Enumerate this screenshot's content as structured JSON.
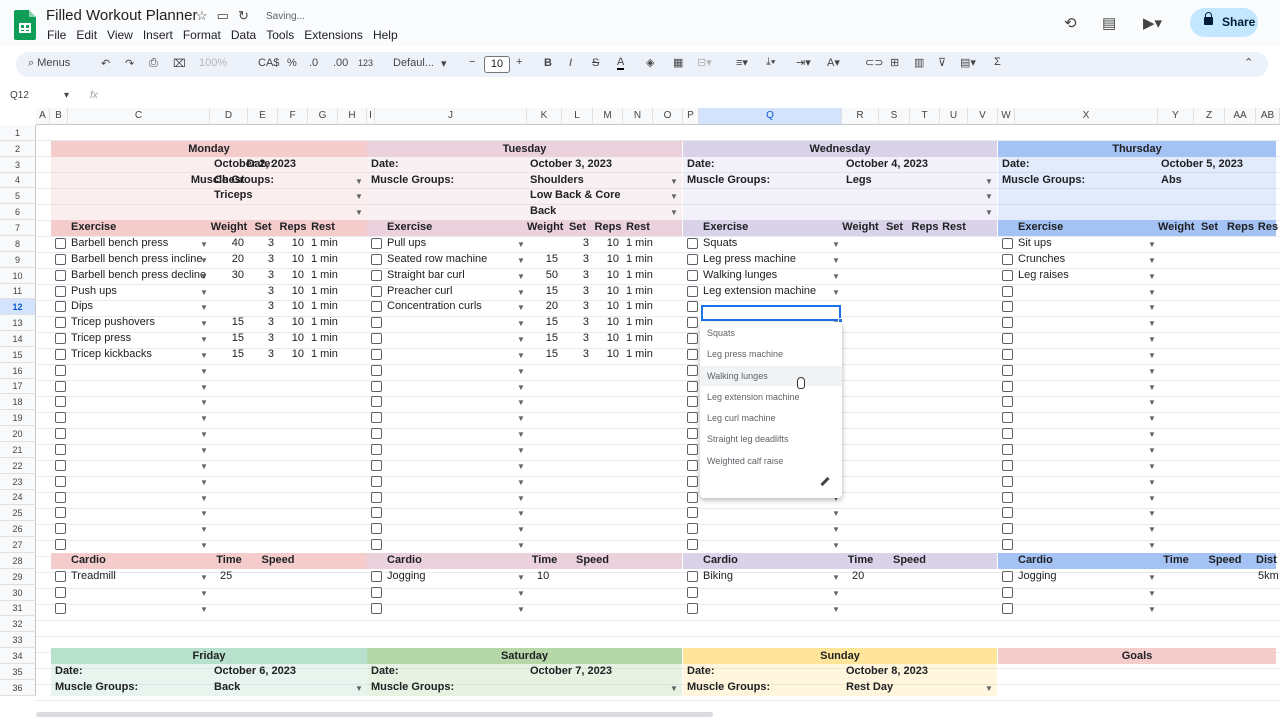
{
  "app": {
    "title": "Filled Workout Planner",
    "saving": "Saving...",
    "menus": [
      "File",
      "Edit",
      "View",
      "Insert",
      "Format",
      "Data",
      "Tools",
      "Extensions",
      "Help"
    ],
    "share": "Share"
  },
  "toolbar": {
    "search": "Menus",
    "zoom": "100%",
    "currency": "CA$",
    "percent": "%",
    "dec_less": ".0",
    "dec_more": ".00",
    "number_format": "123",
    "font": "Defaul...",
    "font_size": "10"
  },
  "formula": {
    "cell_ref": "Q12",
    "fx": "fx",
    "value": ""
  },
  "columns": [
    "A",
    "B",
    "C",
    "D",
    "E",
    "F",
    "G",
    "H",
    "I",
    "J",
    "K",
    "L",
    "M",
    "N",
    "O",
    "P",
    "Q",
    "R",
    "S",
    "T",
    "U",
    "V",
    "W",
    "X",
    "Y",
    "Z",
    "AA",
    "AB"
  ],
  "rows": [
    "1",
    "2",
    "3",
    "4",
    "5",
    "6",
    "7",
    "8",
    "9",
    "10",
    "11",
    "12",
    "13",
    "14",
    "15",
    "16",
    "17",
    "18",
    "19",
    "20",
    "21",
    "22",
    "23",
    "24",
    "25",
    "26",
    "27",
    "28",
    "29",
    "30",
    "31",
    "32",
    "33",
    "34",
    "35",
    "36"
  ],
  "labels": {
    "date": "Date:",
    "muscle": "Muscle Groups:",
    "exercise": "Exercise",
    "weight": "Weight",
    "set": "Set",
    "reps": "Reps",
    "rest": "Rest",
    "time": "Time",
    "cardio": "Cardio",
    "speed": "Speed",
    "distance": "Distance",
    "distance_cut": "Dist",
    "reps_cut": "Reps",
    "rest_cut": "Res"
  },
  "days": [
    {
      "name": "Monday",
      "date": "October 2, 2023",
      "muscles": [
        "Chest",
        "Triceps",
        ""
      ],
      "exercises": [
        {
          "name": "Barbell bench press",
          "weight": "40",
          "set": "3",
          "reps": "10",
          "rest": "1 min"
        },
        {
          "name": "Barbell bench press incline",
          "weight": "20",
          "set": "3",
          "reps": "10",
          "rest": "1 min"
        },
        {
          "name": "Barbell bench press decline",
          "weight": "30",
          "set": "3",
          "reps": "10",
          "rest": "1 min"
        },
        {
          "name": "Push ups",
          "weight": "",
          "set": "3",
          "reps": "10",
          "rest": "1 min"
        },
        {
          "name": "Dips",
          "weight": "",
          "set": "3",
          "reps": "10",
          "rest": "1 min"
        },
        {
          "name": "Tricep pushovers",
          "weight": "15",
          "set": "3",
          "reps": "10",
          "rest": "1 min"
        },
        {
          "name": "Tricep press",
          "weight": "15",
          "set": "3",
          "reps": "10",
          "rest": "1 min"
        },
        {
          "name": "Tricep kickbacks",
          "weight": "15",
          "set": "3",
          "reps": "10",
          "rest": "1 min"
        }
      ],
      "cardio": {
        "name": "Treadmill",
        "time": "25"
      }
    },
    {
      "name": "Tuesday",
      "date": "October 3, 2023",
      "muscles": [
        "Shoulders",
        "Low Back & Core",
        "Back"
      ],
      "exercises": [
        {
          "name": "Pull ups",
          "weight": "",
          "set": "3",
          "reps": "10",
          "rest": "1 min"
        },
        {
          "name": "Seated row machine",
          "weight": "15",
          "set": "3",
          "reps": "10",
          "rest": "1 min"
        },
        {
          "name": "Straight bar curl",
          "weight": "50",
          "set": "3",
          "reps": "10",
          "rest": "1 min"
        },
        {
          "name": "Preacher curl",
          "weight": "15",
          "set": "3",
          "reps": "10",
          "rest": "1 min"
        },
        {
          "name": "Concentration curls",
          "weight": "20",
          "set": "3",
          "reps": "10",
          "rest": "1 min"
        },
        {
          "name": "",
          "weight": "15",
          "set": "3",
          "reps": "10",
          "rest": "1 min"
        },
        {
          "name": "",
          "weight": "15",
          "set": "3",
          "reps": "10",
          "rest": "1 min"
        },
        {
          "name": "",
          "weight": "15",
          "set": "3",
          "reps": "10",
          "rest": "1 min"
        }
      ],
      "cardio": {
        "name": "Jogging",
        "time": "10"
      }
    },
    {
      "name": "Wednesday",
      "date": "October 4, 2023",
      "muscles": [
        "Legs",
        "",
        ""
      ],
      "exercises": [
        {
          "name": "Squats"
        },
        {
          "name": "Leg press machine"
        },
        {
          "name": "Walking lunges"
        },
        {
          "name": "Leg extension machine"
        }
      ],
      "cardio": {
        "name": "Biking",
        "time": "20"
      }
    },
    {
      "name": "Thursday",
      "date": "October 5, 2023",
      "muscles": [
        "Abs",
        "",
        ""
      ],
      "exercises": [
        {
          "name": "Sit ups"
        },
        {
          "name": "Crunches"
        },
        {
          "name": "Leg raises"
        }
      ],
      "cardio": {
        "name": "Jogging",
        "time": "",
        "distance": "5km"
      }
    }
  ],
  "week2": [
    {
      "name": "Friday",
      "date": "October 6, 2023",
      "muscle": "Back"
    },
    {
      "name": "Saturday",
      "date": "October 7, 2023",
      "muscle": ""
    },
    {
      "name": "Sunday",
      "date": "October 8, 2023",
      "muscle": "Rest Day"
    },
    {
      "name": "Goals"
    }
  ],
  "dropdown": {
    "options": [
      "Squats",
      "Leg press machine",
      "Walking lunges",
      "Leg extension machine",
      "Leg curl machine",
      "Straight leg deadlifts",
      "Weighted calf raise"
    ]
  },
  "colors": {
    "monday": "#f4cccc",
    "tuesday": "#ead1dc",
    "wednesday": "#d9d2e9",
    "thursday": "#a4c2f4",
    "friday": "#b7e1cd",
    "saturday": "#b6d7a8",
    "sunday": "#ffe599",
    "goals": "#f4cccc",
    "accent": "#1a73e8"
  }
}
